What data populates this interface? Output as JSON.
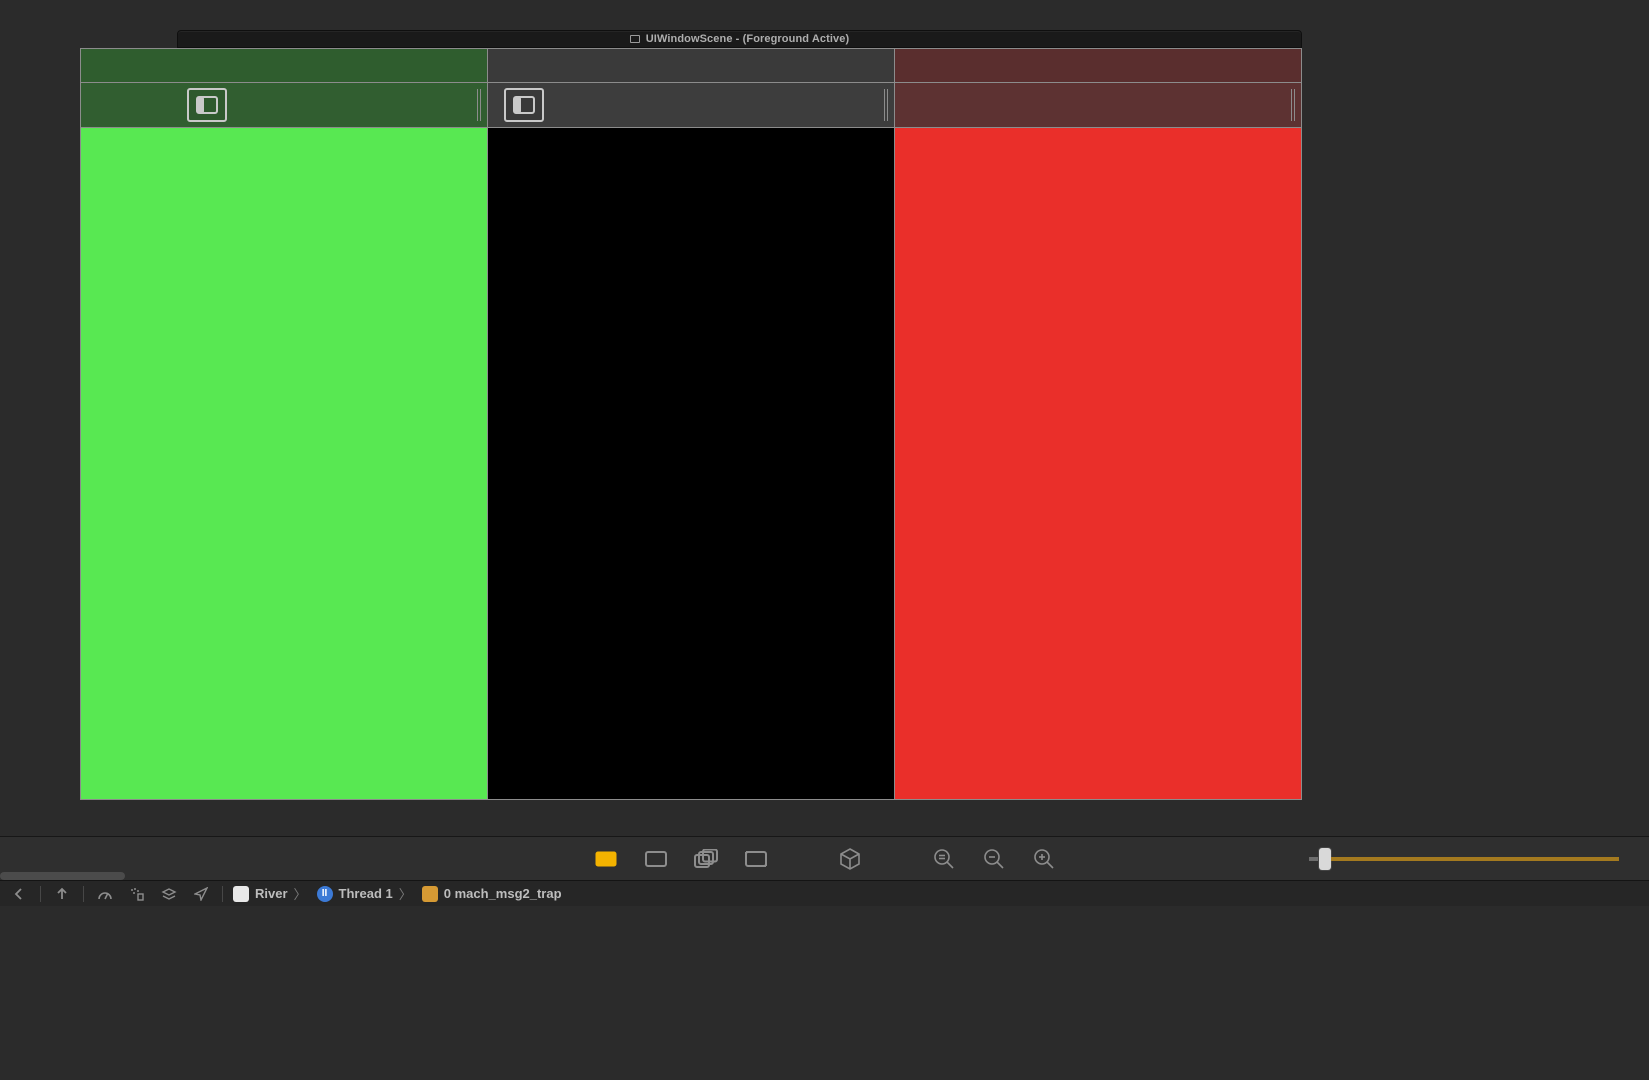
{
  "scene": {
    "title": "UIWindowScene - (Foreground Active)"
  },
  "columns": [
    {
      "tint": "green",
      "has_sidebar_button": true
    },
    {
      "tint": "black",
      "has_sidebar_button": true
    },
    {
      "tint": "red",
      "has_sidebar_button": false
    }
  ],
  "toolbar": {
    "modes": [
      {
        "name": "mode-content",
        "active": true
      },
      {
        "name": "mode-wireframe",
        "active": false
      },
      {
        "name": "mode-layers",
        "active": false
      },
      {
        "name": "mode-clipped",
        "active": false
      }
    ],
    "orient3d_name": "orient-3d",
    "zoom_tools": [
      {
        "name": "zoom-actual"
      },
      {
        "name": "zoom-out"
      },
      {
        "name": "zoom-in"
      }
    ]
  },
  "breadcrumb": {
    "app": "River",
    "thread": "Thread 1",
    "pause_label": "II",
    "frame": "0 mach_msg2_trap"
  }
}
